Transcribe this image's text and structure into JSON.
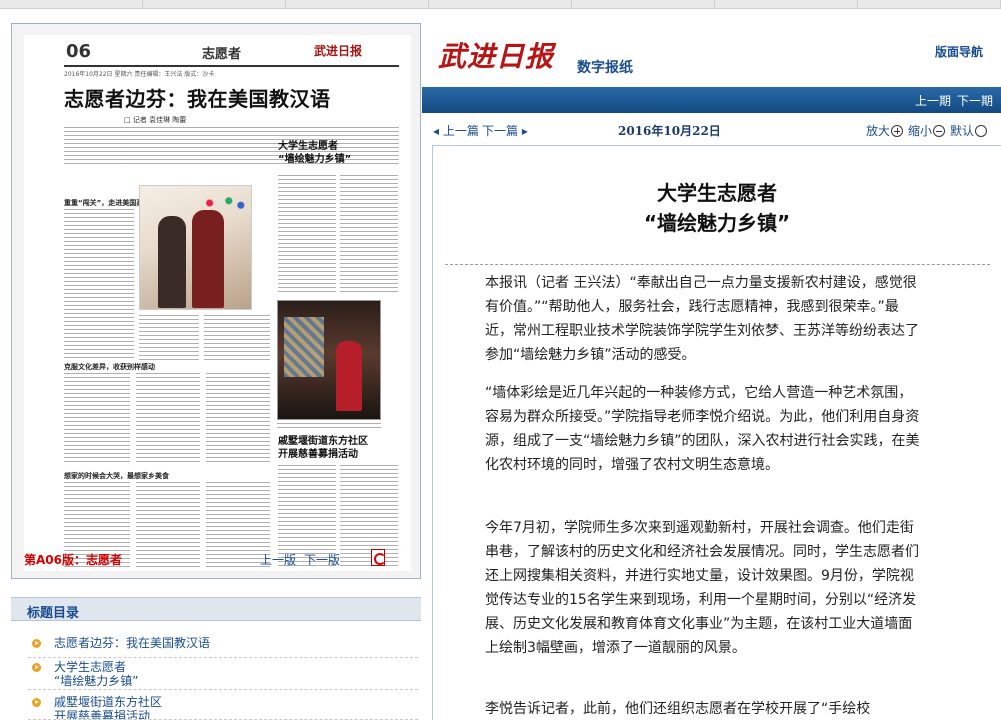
{
  "newspaper_page": {
    "page_number": "06",
    "section": "志愿者",
    "masthead_small": "武进日报",
    "dateline": "2016年10月22日 星期六 责任编辑：王兴法 版式：沙卡",
    "headline": "志愿者边芬：我在美国教汉语",
    "byline": "□ 记者 袁佳琳 陶蕾",
    "subhead_1": "重重“闯关”，走进美国高中课堂",
    "subhead_2": "克服文化差异，收获别样感动",
    "subhead_3": "想家的时候会大哭，最想家乡美食",
    "box1_title_line1": "大学生志愿者",
    "box1_title_line2": "“墙绘魅力乡镇”",
    "box2_title_line1": "戚墅堰街道东方社区",
    "box2_title_line2": "开展慈善募捐活动"
  },
  "page_footer": {
    "label": "第A06版：志愿者",
    "prev": "上一版",
    "next": "下一版"
  },
  "toc": {
    "title": "标题目录",
    "items": [
      {
        "line1": "志愿者边芬：我在美国教汉语",
        "line2": ""
      },
      {
        "line1": "大学生志愿者",
        "line2": "“墙绘魅力乡镇”"
      },
      {
        "line1": "戚墅堰街道东方社区",
        "line2": "开展慈善募捐活动"
      }
    ]
  },
  "header": {
    "brand": "武进日报",
    "tagline": "数字报纸",
    "nav": "版面导航",
    "prev_issue": "上一期",
    "next_issue": "下一期"
  },
  "toolbar": {
    "prev_article": "上一篇",
    "next_article": "下一篇",
    "date": "2016年10月22日",
    "zoom_in": "放大",
    "zoom_out": "缩小",
    "default": "默认"
  },
  "article": {
    "title_line1": "大学生志愿者",
    "title_line2": "“墙绘魅力乡镇”",
    "paragraphs": [
      "  本报讯（记者 王兴法）“奉献出自己一点力量支援新农村建设，感觉很有价值。”“帮助他人，服务社会，践行志愿精神，我感到很荣幸。”最近，常州工程职业技术学院装饰学院学生刘依梦、王苏洋等纷纷表达了参加“墙绘魅力乡镇”活动的感受。",
      "  “墙体彩绘是近几年兴起的一种装修方式，它给人营造一种艺术氛围，容易为群众所接受。”学院指导老师李悦介绍说。为此，他们利用自身资源，组成了一支“墙绘魅力乡镇”的团队，深入农村进行社会实践，在美化农村环境的同时，增强了农村文明生态意境。",
      "  今年7月初，学院师生多次来到遥观勤新村，开展社会调查。他们走街串巷，了解该村的历史文化和经济社会发展情况。同时，学生志愿者们还上网搜集相关资料，并进行实地丈量，设计效果图。9月份，学院视觉传达专业的15名学生来到现场，利用一个星期时间，分别以“经济发展、历史文化发展和教育体育文化事业”为主题，在该村工业大道墙面上绘制3幅壁画，增添了一道靓丽的风景。",
      "  李悦告诉记者，此前，他们还组织志愿者在学校开展了“手绘校"
    ]
  },
  "colors": {
    "accent_blue": "#1a4d8f",
    "bar_blue": "#124a82",
    "brand_red": "#b81414",
    "page_label_red": "#d40000",
    "bullet_orange": "#f0a020"
  }
}
